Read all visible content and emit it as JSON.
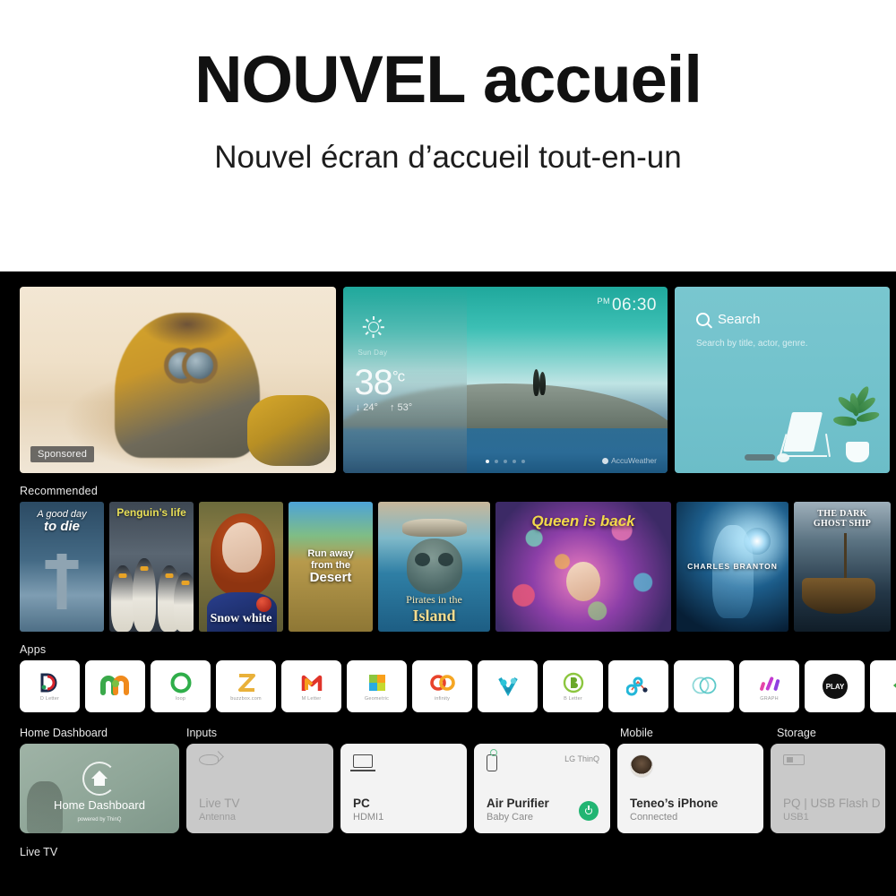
{
  "promo": {
    "title_lead": "NOUVEL",
    "title_tail": "accueil",
    "subtitle": "Nouvel écran d’accueil tout-en-un"
  },
  "hero": {
    "sponsored_badge": "Sponsored",
    "weather": {
      "condition_label": "Sun Day",
      "temperature": "38",
      "unit": "°c",
      "low": "↓ 24°",
      "high": "↑ 53°",
      "clock_ampm": "PM",
      "clock_time": "06:30",
      "provider": "AccuWeather",
      "dot_count": 5,
      "active_dot": 1
    },
    "search": {
      "title": "Search",
      "subtitle": "Search by title, actor, genre.",
      "icon": "search-icon"
    }
  },
  "recommended": {
    "label": "Recommended",
    "items": [
      {
        "line1": "A good day",
        "line2": "to die"
      },
      {
        "line1": "Penguin’s life",
        "line2": ""
      },
      {
        "line1": "Snow white",
        "line2": ""
      },
      {
        "line1": "Run away",
        "line2": "from the",
        "line3": "Desert"
      },
      {
        "line1": "Pirates in the",
        "line2": "Island"
      },
      {
        "line1": "Queen is back",
        "line2": ""
      },
      {
        "line1": "CHARLES BRANTON",
        "line2": ""
      },
      {
        "line1": "THE DARK",
        "line2": "GHOST SHIP"
      }
    ]
  },
  "apps": {
    "label": "Apps",
    "items": [
      {
        "caption": "D Letter",
        "icon": "app-d-letter-icon"
      },
      {
        "caption": "",
        "icon": "app-m-icon"
      },
      {
        "caption": "loop",
        "icon": "app-loop-icon"
      },
      {
        "caption": "buzzbox.com",
        "icon": "app-z-icon"
      },
      {
        "caption": "M Letter",
        "icon": "app-m-red-icon"
      },
      {
        "caption": "Geometric",
        "icon": "app-geometric-icon"
      },
      {
        "caption": "infinity",
        "icon": "app-infinity-icon"
      },
      {
        "caption": "",
        "icon": "app-v-icon"
      },
      {
        "caption": "B Letter",
        "icon": "app-b-letter-icon"
      },
      {
        "caption": "",
        "icon": "app-molecule-icon"
      },
      {
        "caption": "",
        "icon": "app-rings-icon"
      },
      {
        "caption": "GRAPH",
        "icon": "app-graph-icon"
      },
      {
        "caption": "PLAY",
        "icon": "app-play-icon"
      },
      {
        "caption": "",
        "icon": "app-partial-icon"
      }
    ]
  },
  "dashboard": {
    "group_labels": {
      "home_dashboard": "Home Dashboard",
      "inputs": "Inputs",
      "mobile": "Mobile",
      "storage": "Storage"
    },
    "tiles": [
      {
        "name": "Home Dashboard",
        "sub": "powered by ThinQ",
        "icon": "home-dashboard-icon"
      },
      {
        "name": "Live TV",
        "sub": "Antenna",
        "icon": "antenna-icon"
      },
      {
        "name": "PC",
        "sub": "HDMI1",
        "icon": "monitor-icon"
      },
      {
        "name": "Air Purifier",
        "sub": "Baby Care",
        "icon": "air-purifier-icon",
        "badge": "LG ThinQ",
        "power": true
      },
      {
        "name": "Teneo’s iPhone",
        "sub": "Connected",
        "icon": "avatar"
      },
      {
        "name": "PQ | USB Flash D",
        "sub": "USB1",
        "icon": "usb-icon"
      }
    ]
  },
  "bottom": {
    "label": "Live TV"
  },
  "colors": {
    "panel_bg": "#000000",
    "accent_green": "#22b573",
    "weather_teal": "#1fa89c",
    "search_teal": "#72c2cc"
  }
}
